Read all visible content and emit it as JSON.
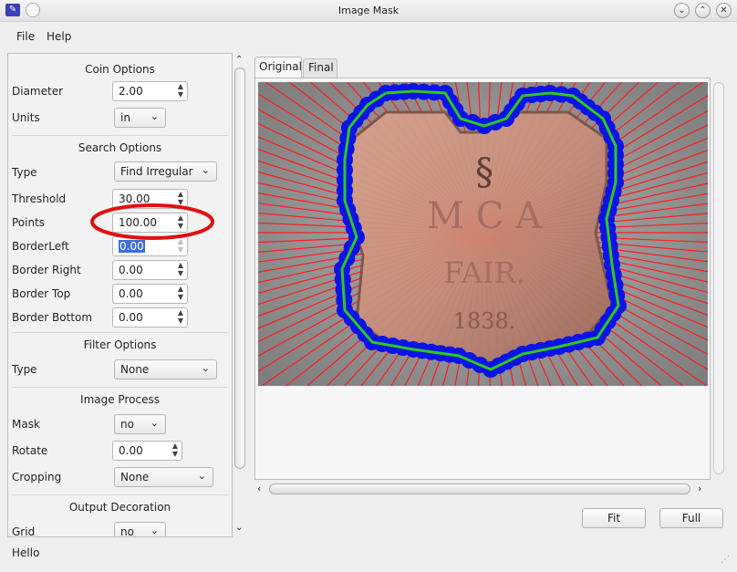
{
  "window": {
    "title": "Image Mask"
  },
  "menu": {
    "file": "File",
    "help": "Help"
  },
  "coin_options": {
    "title": "Coin Options",
    "diameter_label": "Diameter",
    "diameter_value": "2.00",
    "units_label": "Units",
    "units_value": "in"
  },
  "search_options": {
    "title": "Search Options",
    "type_label": "Type",
    "type_value": "Find Irregular",
    "threshold_label": "Threshold",
    "threshold_value": "30.00",
    "points_label": "Points",
    "points_value": "100.00",
    "border_left_label": "BorderLeft",
    "border_left_value": "0.00",
    "border_right_label": "Border Right",
    "border_right_value": "0.00",
    "border_top_label": "Border Top",
    "border_top_value": "0.00",
    "border_bottom_label": "Border Bottom",
    "border_bottom_value": "0.00"
  },
  "filter_options": {
    "title": "Filter Options",
    "type_label": "Type",
    "type_value": "None"
  },
  "image_process": {
    "title": "Image Process",
    "mask_label": "Mask",
    "mask_value": "no",
    "rotate_label": "Rotate",
    "rotate_value": "0.00",
    "cropping_label": "Cropping",
    "cropping_value": "None"
  },
  "output_decoration": {
    "title": "Output Decoration",
    "grid_label": "Grid",
    "grid_value": "no"
  },
  "tabs": {
    "original": "Original",
    "final": "Final"
  },
  "buttons": {
    "fit": "Fit",
    "full": "Full"
  },
  "status": "Hello",
  "image_text": {
    "line1": "M C   A",
    "line2": "FAIR.",
    "line3": "1838."
  },
  "colors": {
    "rays": "#ff1a1a",
    "outline": "#2fc81e",
    "points": "#0a14e6",
    "highlight_circle": "#e01010"
  }
}
